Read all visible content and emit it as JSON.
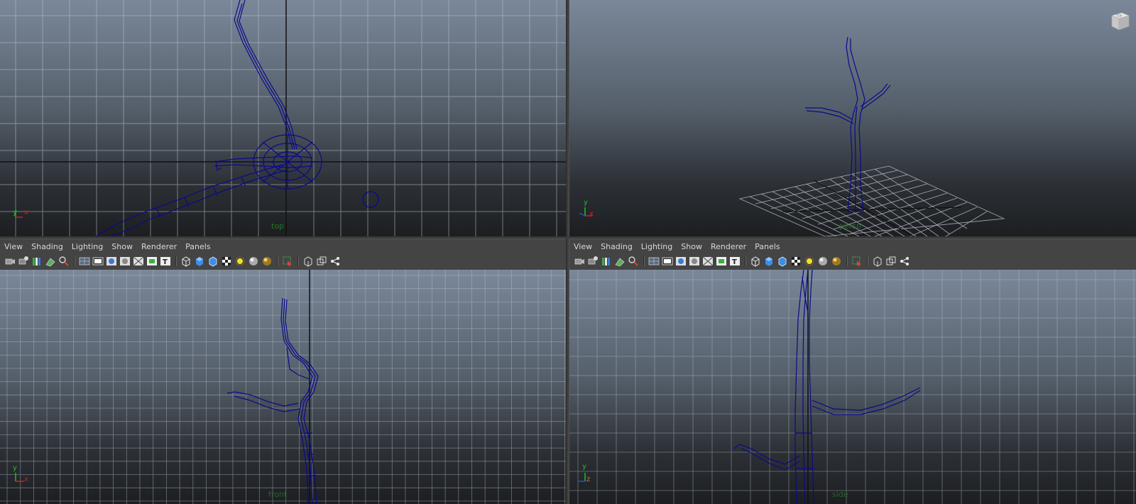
{
  "panels": [
    {
      "id": "top",
      "camera_label": "top",
      "axes": {
        "h": "x",
        "v": "y"
      }
    },
    {
      "id": "persp",
      "camera_label": "persp",
      "axes": {
        "h": "x",
        "v": "y"
      },
      "viewcube_label": "TOP"
    },
    {
      "id": "front",
      "camera_label": "front",
      "axes": {
        "h": "x",
        "v": "y"
      }
    },
    {
      "id": "side",
      "camera_label": "side",
      "axes": {
        "h": "z",
        "v": "y"
      }
    }
  ],
  "panel_menu": {
    "view": "View",
    "shading": "Shading",
    "lighting": "Lighting",
    "show": "Show",
    "renderer": "Renderer",
    "panels": "Panels"
  },
  "toolbar_icons": [
    "camera-select-icon",
    "camera-attributes-icon",
    "bookmark-icon",
    "image-plane-icon",
    "two-d-pan-zoom-icon",
    "grid-icon",
    "film-gate-icon",
    "resolution-gate-icon",
    "gate-mask-icon",
    "field-chart-icon",
    "safe-action-icon",
    "safe-title-icon",
    "wireframe-icon",
    "smooth-shade-icon",
    "bounding-box-icon",
    "textured-icon",
    "default-light-icon",
    "all-lights-icon",
    "shadows-icon",
    "isolate-select-icon",
    "xray-icon",
    "xray-joints-icon",
    "xray-components-icon"
  ],
  "colors": {
    "wireframe": "#0a0a8a",
    "grid": "#b8c0cc",
    "axis_x": "#d42020",
    "axis_y": "#20c020",
    "axis_z": "#2050e0",
    "axis_z_side": "#e07020"
  }
}
